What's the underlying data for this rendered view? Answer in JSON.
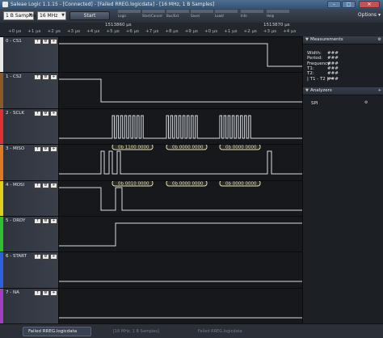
{
  "window": {
    "title": "Saleae Logic 1.1.15 - [Connected] - [Failed RREG.logicdata] - [16 MHz, 1 B Samples]",
    "minimize_glyph": "–",
    "maximize_glyph": "□",
    "close_glyph": "✕"
  },
  "toolbar": {
    "samples_value": "1 B Samples",
    "rate_value": "16 MHz",
    "start_label": "Start",
    "thumb_labels": [
      "Logic",
      "Start/Cancel",
      "Bus/Ext",
      "Save/",
      "Load/",
      "Info",
      "Help"
    ],
    "options_label": "Options"
  },
  "timescale": {
    "major_left": "1513860 µs",
    "major_right": "1513870 µs",
    "minor_ticks": [
      "+0 µs",
      "+1 µs",
      "+2 µs",
      "+3 µs",
      "+4 µs",
      "+5 µs",
      "+6 µs",
      "+7 µs",
      "+8 µs",
      "+9 µs",
      "+0 µs",
      "+1 µs",
      "+2 µs",
      "+3 µs",
      "+4 µs"
    ]
  },
  "channels": [
    {
      "name": "0 - CS1",
      "color": "#e8e8e8"
    },
    {
      "name": "1 - CS2",
      "color": "#8b5a2b"
    },
    {
      "name": "2 - SCLK",
      "color": "#e03030"
    },
    {
      "name": "3 - MISO",
      "color": "#e07a20"
    },
    {
      "name": "4 - MOSI",
      "color": "#e0d020"
    },
    {
      "name": "5 - DRDY",
      "color": "#30c030"
    },
    {
      "name": "6 - START",
      "color": "#3060e0"
    },
    {
      "name": "7 - NA",
      "color": "#a040c0"
    }
  ],
  "channel_button_glyphs": [
    "f",
    "⚙",
    "+"
  ],
  "decoded": {
    "miso": [
      "0b 1100 0000",
      "0b 0000 0000",
      "0b 0000 0000"
    ],
    "mosi": [
      "0b 0010 0000",
      "0b 0000 0000",
      "0b 0000 0000"
    ]
  },
  "measurements": {
    "title": "Measurements",
    "rows": [
      {
        "label": "Width:",
        "value": "###"
      },
      {
        "label": "Period:",
        "value": "###"
      },
      {
        "label": "Frequency:",
        "value": "###"
      },
      {
        "label": "T1:",
        "value": "###"
      },
      {
        "label": "T2:",
        "value": "###"
      },
      {
        "label": "| T1 - T2 | =",
        "value": "###"
      }
    ]
  },
  "analyzers": {
    "title": "Analyzers",
    "items": [
      "SPI"
    ]
  },
  "status": {
    "tab_label": "Failed RREG.logicdata",
    "dim_text_1": "[16 MHz, 1 B Samples]",
    "dim_text_2": "Failed RREG.logicdata"
  },
  "colors": {
    "signal": "#d8dde4",
    "decode_fill": "#e6e1b4",
    "decode_bg": "#2a2a28"
  }
}
